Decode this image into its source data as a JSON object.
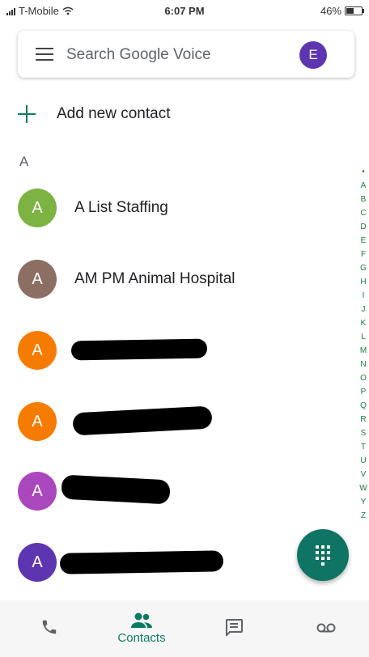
{
  "status_bar": {
    "carrier": "T-Mobile",
    "time": "6:07 PM",
    "battery": "46%"
  },
  "search": {
    "placeholder": "Search Google Voice",
    "account_initial": "E",
    "account_color": "#5e35b1"
  },
  "add_contact": {
    "label": "Add new contact"
  },
  "section": {
    "letter": "A"
  },
  "contacts": [
    {
      "initial": "A",
      "name": "A List Staffing",
      "color": "#7cb342"
    },
    {
      "initial": "A",
      "name": "AM PM Animal Hospital",
      "color": "#8d6e63"
    },
    {
      "initial": "A",
      "name": "",
      "color": "#f57c00",
      "redacted": true
    },
    {
      "initial": "A",
      "name": "",
      "color": "#f57c00",
      "redacted": true
    },
    {
      "initial": "A",
      "name": "",
      "color": "#ab47bc",
      "redacted": true
    },
    {
      "initial": "A",
      "name": "",
      "color": "#5e35b1",
      "redacted": true
    }
  ],
  "alphabet_index": [
    "•",
    "A",
    "B",
    "C",
    "D",
    "E",
    "F",
    "G",
    "H",
    "I",
    "J",
    "K",
    "L",
    "M",
    "N",
    "O",
    "P",
    "Q",
    "R",
    "S",
    "T",
    "U",
    "V",
    "W",
    "Y",
    "Z"
  ],
  "fab": {
    "icon": "dialpad-icon",
    "color": "#0f7463"
  },
  "bottom_nav": {
    "items": [
      {
        "icon": "phone-icon",
        "label": ""
      },
      {
        "icon": "people-icon",
        "label": "Contacts",
        "active": true
      },
      {
        "icon": "message-icon",
        "label": ""
      },
      {
        "icon": "voicemail-icon",
        "label": ""
      }
    ]
  },
  "accent_color": "#0b7a62"
}
